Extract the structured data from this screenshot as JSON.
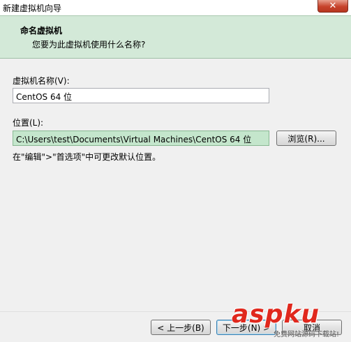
{
  "window": {
    "title": "新建虚拟机向导",
    "close_symbol": "✕"
  },
  "header": {
    "title": "命名虚拟机",
    "subtitle": "您要为此虚拟机使用什么名称?"
  },
  "form": {
    "name_label": "虚拟机名称(V):",
    "name_value": "CentOS 64 位",
    "location_label": "位置(L):",
    "location_value": "C:\\Users\\test\\Documents\\Virtual Machines\\CentOS 64 位",
    "browse_label": "浏览(R)...",
    "hint": "在\"编辑\">\"首选项\"中可更改默认位置。"
  },
  "footer": {
    "back_label": "< 上一步(B)",
    "next_label": "下一步(N) >",
    "cancel_label": "取消"
  },
  "watermark": {
    "brand": "aspku",
    "tagline": "免费网站源码下载站!"
  },
  "colors": {
    "header_bg": "#d3e9d8",
    "selection_bg": "#c4e6cc",
    "watermark_red": "#e0281d"
  }
}
